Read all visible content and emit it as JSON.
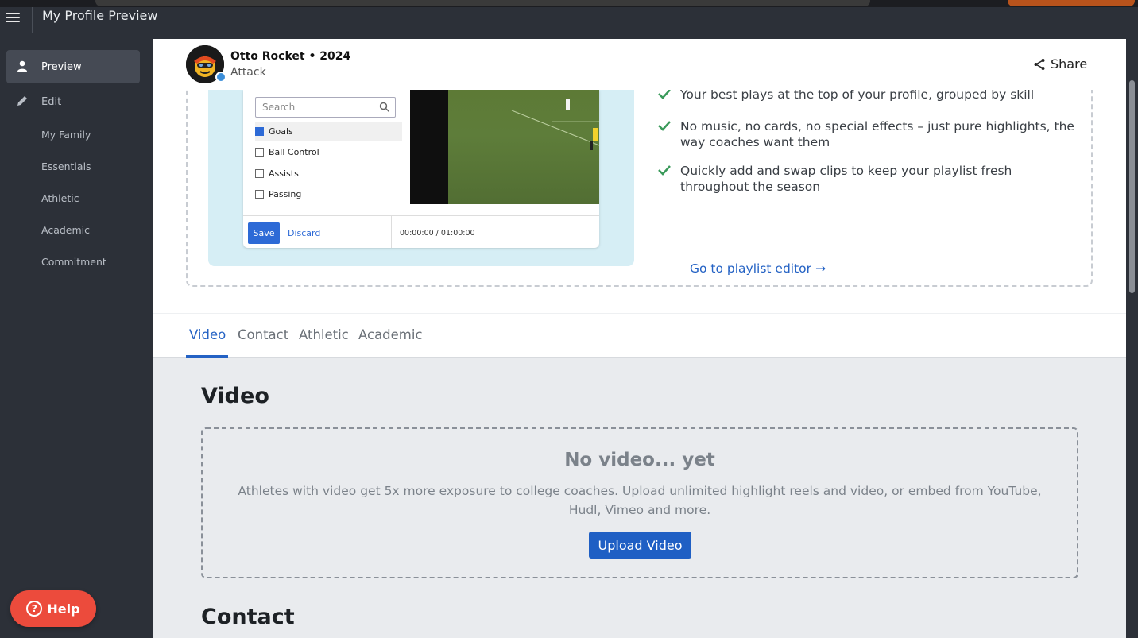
{
  "topbar": {
    "title": "My Profile Preview"
  },
  "sidebar": {
    "items": [
      {
        "label": "Preview",
        "icon": "user-icon"
      },
      {
        "label": "Edit",
        "icon": "pencil-icon"
      }
    ],
    "subitems": [
      "My Family",
      "Essentials",
      "Athletic",
      "Academic",
      "Commitment"
    ]
  },
  "help": {
    "label": "Help"
  },
  "profile": {
    "name": "Otto Rocket • 2024",
    "position": "Attack",
    "share_label": "Share"
  },
  "promo": {
    "mock": {
      "search_placeholder": "Search",
      "options": [
        "Goals",
        "Ball Control",
        "Assists",
        "Passing"
      ],
      "save_label": "Save",
      "discard_label": "Discard",
      "timecode": "00:00:00 / 01:00:00"
    },
    "benefits": [
      "Your best plays at the top of your profile, grouped by skill",
      "No music, no cards, no special effects – just pure highlights, the way coaches want them",
      "Quickly add and swap clips to keep your playlist fresh throughout the season"
    ],
    "link_label": "Go to playlist editor →"
  },
  "tabs": [
    "Video",
    "Contact",
    "Athletic",
    "Academic"
  ],
  "video_section": {
    "title": "Video",
    "empty_heading": "No video... yet",
    "empty_text": "Athletes with video get 5x more exposure to college coaches. Upload unlimited highlight reels and video, or embed from YouTube, Hudl, Vimeo and more.",
    "upload_label": "Upload Video"
  },
  "contact_section": {
    "title": "Contact"
  },
  "colors": {
    "accent": "#2462c4",
    "help": "#ec4b3c",
    "sidebar": "#2c3038"
  }
}
